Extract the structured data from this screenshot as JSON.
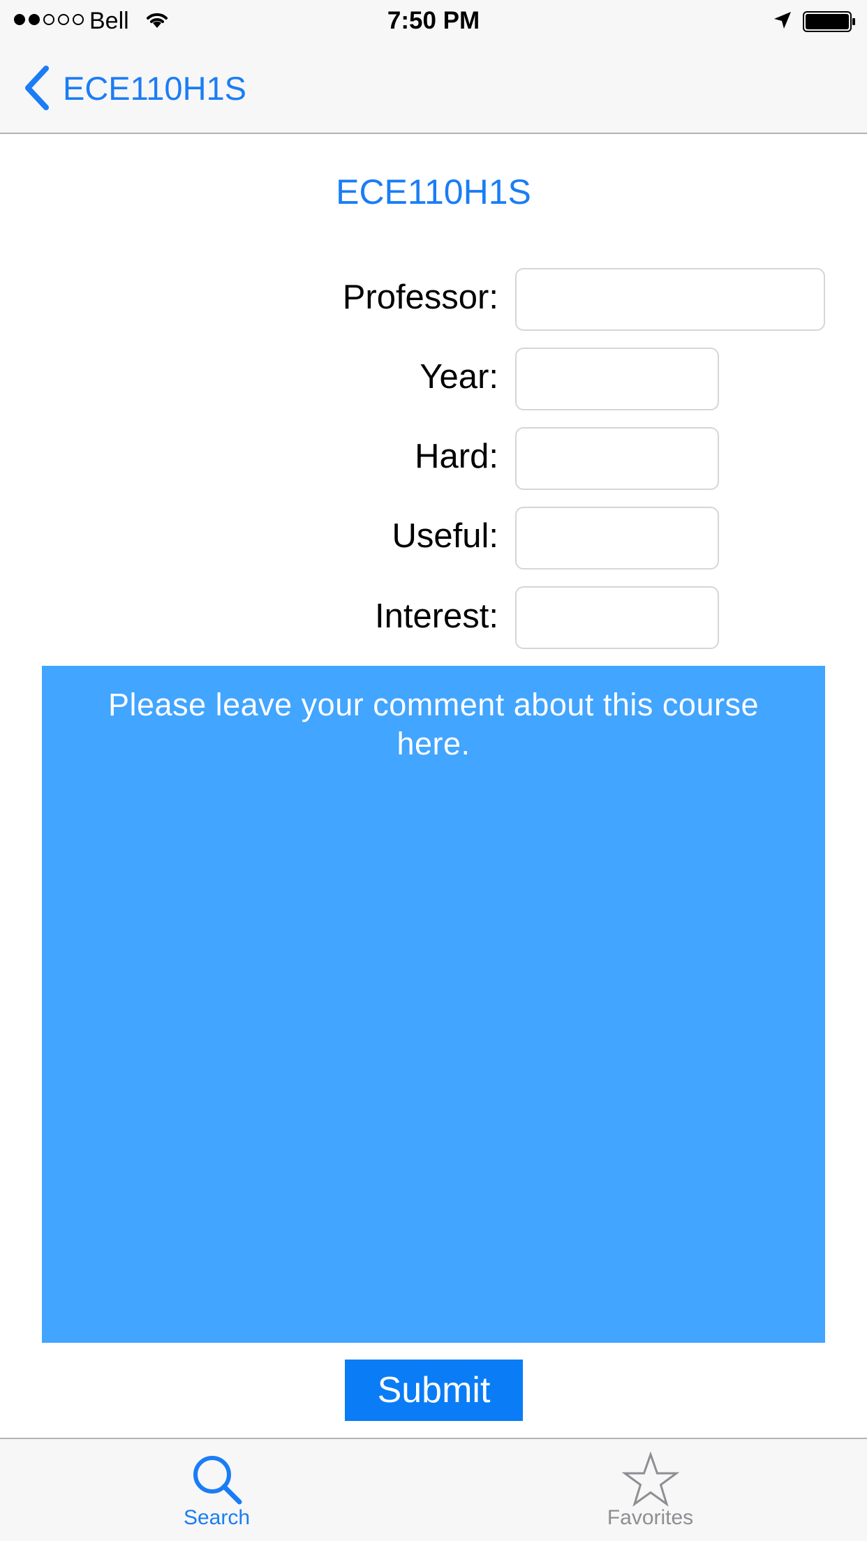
{
  "status_bar": {
    "carrier": "Bell",
    "time": "7:50 PM",
    "signal_bars_filled": 2,
    "signal_bars_total": 5,
    "icons": [
      "signal-dots-icon",
      "wifi-icon",
      "location-arrow-icon",
      "battery-icon"
    ]
  },
  "nav": {
    "back_label": "ECE110H1S",
    "back_icon": "chevron-left-icon"
  },
  "course": {
    "title": "ECE110H1S"
  },
  "form": {
    "fields": [
      {
        "label": "Professor:",
        "value": "",
        "placeholder": ""
      },
      {
        "label": "Year:",
        "value": "",
        "placeholder": ""
      },
      {
        "label": "Hard:",
        "value": "",
        "placeholder": ""
      },
      {
        "label": "Useful:",
        "value": "",
        "placeholder": ""
      },
      {
        "label": "Interest:",
        "value": "",
        "placeholder": ""
      }
    ],
    "comment_text": "Please leave your comment about this course here.",
    "submit_label": "Submit"
  },
  "tab_bar": {
    "tabs": [
      {
        "label": "Search",
        "icon": "search-icon",
        "selected": true
      },
      {
        "label": "Favorites",
        "icon": "star-icon",
        "selected": false
      }
    ]
  },
  "colors": {
    "accent": "#1a7df5",
    "comment_bg": "#42a5ff",
    "submit_bg": "#0a7cf6",
    "bar_bg": "#f7f7f7",
    "inactive_tab": "#8e8e93"
  }
}
